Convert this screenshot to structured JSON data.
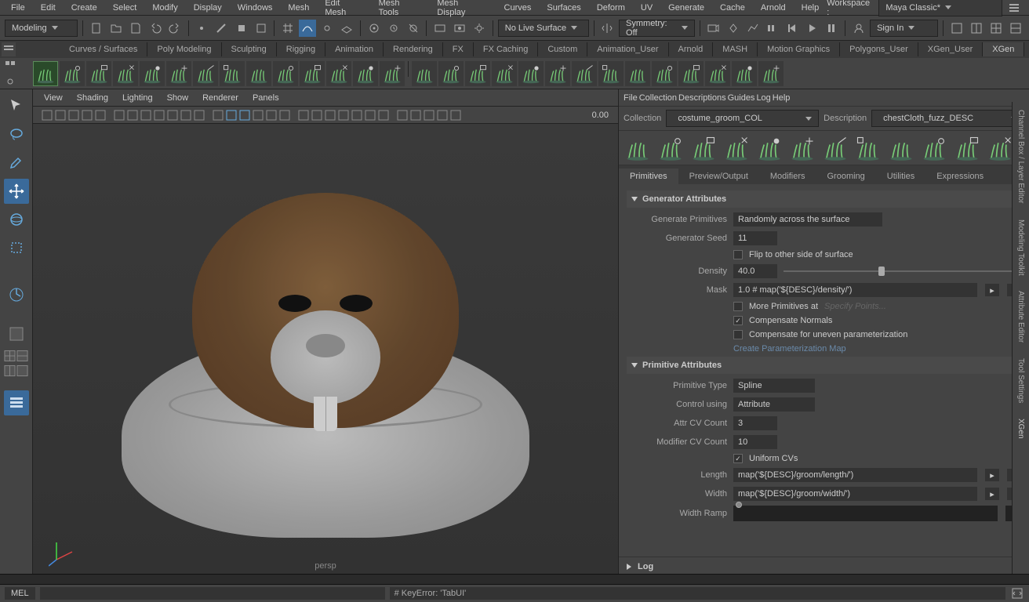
{
  "menubar": [
    "File",
    "Edit",
    "Create",
    "Select",
    "Modify",
    "Display",
    "Windows",
    "Mesh",
    "Edit Mesh",
    "Mesh Tools",
    "Mesh Display",
    "Curves",
    "Surfaces",
    "Deform",
    "UV",
    "Generate",
    "Cache",
    "Arnold",
    "Help"
  ],
  "workspace": {
    "label": "Workspace :",
    "value": "Maya Classic*"
  },
  "mode_selector": "Modeling",
  "status": {
    "live_surface": "No Live Surface",
    "symmetry": "Symmetry: Off",
    "signin": "Sign In"
  },
  "shelf_tabs": [
    "Curves / Surfaces",
    "Poly Modeling",
    "Sculpting",
    "Rigging",
    "Animation",
    "Rendering",
    "FX",
    "FX Caching",
    "Custom",
    "Animation_User",
    "Arnold",
    "MASH",
    "Motion Graphics",
    "Polygons_User",
    "XGen_User",
    "XGen"
  ],
  "shelf_active": "XGen",
  "viewport_menu": [
    "View",
    "Shading",
    "Lighting",
    "Show",
    "Renderer",
    "Panels"
  ],
  "viewport": {
    "camera": "persp",
    "frame": "0.00"
  },
  "xgen": {
    "menus": [
      "File",
      "Collection",
      "Descriptions",
      "Guides",
      "Log",
      "Help"
    ],
    "collection_label": "Collection",
    "description_label": "Description",
    "collection": "costume_groom_COL",
    "description": "chestCloth_fuzz_DESC",
    "tabs": [
      "Primitives",
      "Preview/Output",
      "Modifiers",
      "Grooming",
      "Utilities",
      "Expressions"
    ],
    "active_tab": "Primitives",
    "sections": {
      "gen_attr": "Generator Attributes",
      "prim_attr": "Primitive Attributes",
      "log": "Log"
    },
    "gen": {
      "generate_primitives_label": "Generate Primitives",
      "generate_primitives": "Randomly across the surface",
      "seed_label": "Generator Seed",
      "seed": "11",
      "flip_label": "Flip to other side of surface",
      "density_label": "Density",
      "density": "40.0",
      "mask_label": "Mask",
      "mask": "1.0 # map('${DESC}/density/')",
      "more_prim_label": "More Primitives at",
      "specify": "Specify Points...",
      "comp_normals_label": "Compensate Normals",
      "comp_uneven_label": "Compensate for uneven parameterization",
      "create_param_map": "Create Parameterization Map"
    },
    "prim": {
      "type_label": "Primitive Type",
      "type": "Spline",
      "control_label": "Control using",
      "control": "Attribute",
      "attr_cv_label": "Attr CV Count",
      "attr_cv": "3",
      "mod_cv_label": "Modifier CV Count",
      "mod_cv": "10",
      "uniform_label": "Uniform CVs",
      "length_label": "Length",
      "length": "map('${DESC}/groom/length/')",
      "width_label": "Width",
      "width": "map('${DESC}/groom/width/')",
      "ramp_label": "Width Ramp"
    }
  },
  "right_tabs": [
    "Channel Box / Layer Editor",
    "Modeling Toolkit",
    "Attribute Editor",
    "Tool Settings",
    "XGen"
  ],
  "cmdline": {
    "lang": "MEL",
    "output": "# KeyError: 'TabUI'"
  }
}
